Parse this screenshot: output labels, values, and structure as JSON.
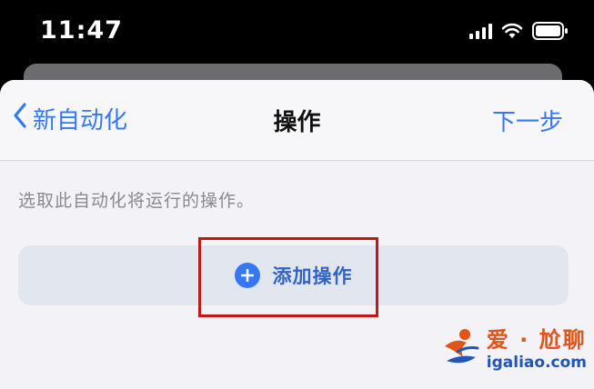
{
  "status_bar": {
    "time": "11:47",
    "icons": [
      "cellular-signal-icon",
      "wifi-icon",
      "battery-icon"
    ]
  },
  "nav": {
    "back_label": "新自动化",
    "title": "操作",
    "next_label": "下一步"
  },
  "content": {
    "hint": "选取此自动化将运行的操作。",
    "add_action_label": "添加操作"
  },
  "watermark": {
    "title": "爱 · 尬聊",
    "url": "igaliao.com"
  },
  "colors": {
    "accent": "#3478f6",
    "highlight": "#c41818",
    "watermark_orange": "#e35418",
    "watermark_blue": "#1f56b8"
  }
}
